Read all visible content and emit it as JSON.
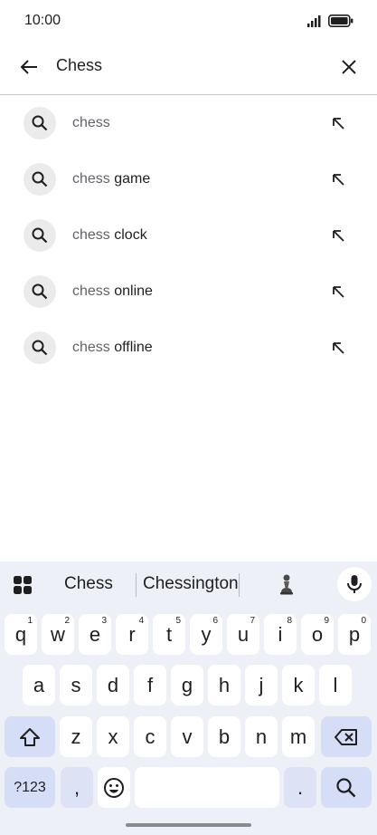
{
  "status_bar": {
    "time": "10:00"
  },
  "search": {
    "query": "Chess"
  },
  "suggestions": [
    {
      "typed": "chess",
      "rest": ""
    },
    {
      "typed": "chess",
      "rest": " game"
    },
    {
      "typed": "chess",
      "rest": " clock"
    },
    {
      "typed": "chess",
      "rest": " online"
    },
    {
      "typed": "chess",
      "rest": " offline"
    }
  ],
  "keyboard": {
    "suggestion_strip": [
      "Chess",
      "Chessington"
    ],
    "row1": [
      {
        "label": "q",
        "hint": "1"
      },
      {
        "label": "w",
        "hint": "2"
      },
      {
        "label": "e",
        "hint": "3"
      },
      {
        "label": "r",
        "hint": "4"
      },
      {
        "label": "t",
        "hint": "5"
      },
      {
        "label": "y",
        "hint": "6"
      },
      {
        "label": "u",
        "hint": "7"
      },
      {
        "label": "i",
        "hint": "8"
      },
      {
        "label": "o",
        "hint": "9"
      },
      {
        "label": "p",
        "hint": "0"
      }
    ],
    "row2": [
      "a",
      "s",
      "d",
      "f",
      "g",
      "h",
      "j",
      "k",
      "l"
    ],
    "row3": [
      "z",
      "x",
      "c",
      "v",
      "b",
      "n",
      "m"
    ],
    "symbols_label": "?123",
    "comma_label": ",",
    "period_label": "."
  },
  "colors": {
    "keyboard_bg": "#eef0f7",
    "key_bg": "#ffffff",
    "action_key_bg": "#d6def7"
  }
}
